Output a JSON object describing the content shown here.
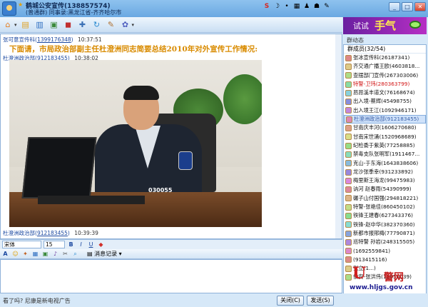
{
  "window": {
    "title": "鹤城公安宣传(138857574)",
    "subtitle": "(普通群) 同事录:黑龙江省-齐齐哈尔市"
  },
  "tray_icons": [
    "sogou-icon",
    "moon-icon",
    "dot-icon",
    "keyboard-icon",
    "person-icon",
    "shirt-icon",
    "tool-icon"
  ],
  "tray_glyphs": [
    "S",
    "☽",
    "•",
    "▦",
    "♟",
    "☗",
    "✎"
  ],
  "toolbar": {
    "items": [
      {
        "name": "home-icon",
        "glyph": "⌂",
        "color": "#e67d20"
      },
      {
        "name": "folder-icon",
        "glyph": "▤",
        "color": "#e0a020"
      },
      {
        "name": "calendar-icon",
        "glyph": "▥",
        "color": "#2f6fc1"
      },
      {
        "name": "picture-icon",
        "glyph": "▣",
        "color": "#3a8a3a"
      },
      {
        "name": "gift-icon",
        "glyph": "◼",
        "color": "#c03030"
      },
      {
        "name": "settings-icon",
        "glyph": "✚",
        "color": "#3a70b5"
      },
      {
        "name": "refresh-icon",
        "glyph": "↻",
        "color": "#2a8ad0"
      },
      {
        "name": "tasks-icon",
        "glyph": "✎",
        "color": "#b07030"
      },
      {
        "name": "apps-icon",
        "glyph": "✿",
        "color": "#5060c0"
      }
    ]
  },
  "ad_banner": {
    "text1": "试试",
    "text2": "手气"
  },
  "right_panel": {
    "group_dynamics_label": "群动态",
    "members_header": "群成员(32/54)",
    "members": [
      {
        "name": "张冰宣传科(26187341)",
        "style": "normal"
      },
      {
        "name": "齐交通广播王欧(4603818...",
        "style": "normal"
      },
      {
        "name": "查摆部门宣传(267303006)",
        "style": "normal"
      },
      {
        "name": "特警-卫玮(280363799)",
        "style": "red"
      },
      {
        "name": "昂昂溪丰道文(76168674)",
        "style": "normal"
      },
      {
        "name": "出入境-蔡辉(45498755)",
        "style": "normal"
      },
      {
        "name": "出入境王江(1092946171)",
        "style": "normal"
      },
      {
        "name": "杜澄洲政治部(912183455)",
        "style": "selected"
      },
      {
        "name": "甘南庆丰河(1606270680)",
        "style": "normal"
      },
      {
        "name": "甘南宋世涌(1520968689)",
        "style": "normal"
      },
      {
        "name": "纪检委于紫英(77258885)",
        "style": "normal"
      },
      {
        "name": "禁毒支队张明军(1911467...",
        "style": "normal"
      },
      {
        "name": "克山-于东海(1643838606)",
        "style": "normal"
      },
      {
        "name": "龙沙张季幸(931233892)",
        "style": "normal"
      },
      {
        "name": "梅里斯王海龙(99475983)",
        "style": "normal"
      },
      {
        "name": "讷河   赵春雨(54390999)",
        "style": "normal"
      },
      {
        "name": "碾子山付国强(294818221)",
        "style": "normal"
      },
      {
        "name": "特警-张艳佳(860450102)",
        "style": "normal"
      },
      {
        "name": "铁锋王建春(627343376)",
        "style": "normal"
      },
      {
        "name": "铁锋-赵中华(382370360)",
        "style": "normal"
      },
      {
        "name": "新都市报邢梅(77790871)",
        "style": "normal"
      },
      {
        "name": "巡特警 孙岩(248315505)",
        "style": "normal"
      },
      {
        "name": "(1692559841)",
        "style": "normal"
      },
      {
        "name": "(913415116)",
        "style": "normal"
      },
      {
        "name": "张立(1...)",
        "style": "normal"
      },
      {
        "name": "依安-张洪伟(12656039)",
        "style": "normal"
      }
    ]
  },
  "chat": {
    "messages": [
      {
        "sender": "张可意宣传科",
        "qq": "1399176348",
        "time": "10:37:51"
      },
      {
        "sender": "杜澄洲政治部",
        "qq": "912183455",
        "time": "10:38:02"
      },
      {
        "sender": "杜澄洲政治部",
        "qq": "912183455",
        "time": "10:39:39"
      }
    ],
    "announcement": "下面请，市局政治部副主任杜澄洲同志简要总结2010年对外宣传工作情况:",
    "photo_badge_number": "030055"
  },
  "format_bar": {
    "font": "宋体",
    "size": "15"
  },
  "input_toolbar": {
    "history_label": "消息记录"
  },
  "status": {
    "ad_text": "看了吗? 尼康是新电视广告"
  },
  "buttons": {
    "close": "关闭(C)",
    "send": "发送(S)"
  },
  "logo": {
    "u": "U",
    "text": "警网",
    "url": "www.hljgs.gov.cn"
  }
}
